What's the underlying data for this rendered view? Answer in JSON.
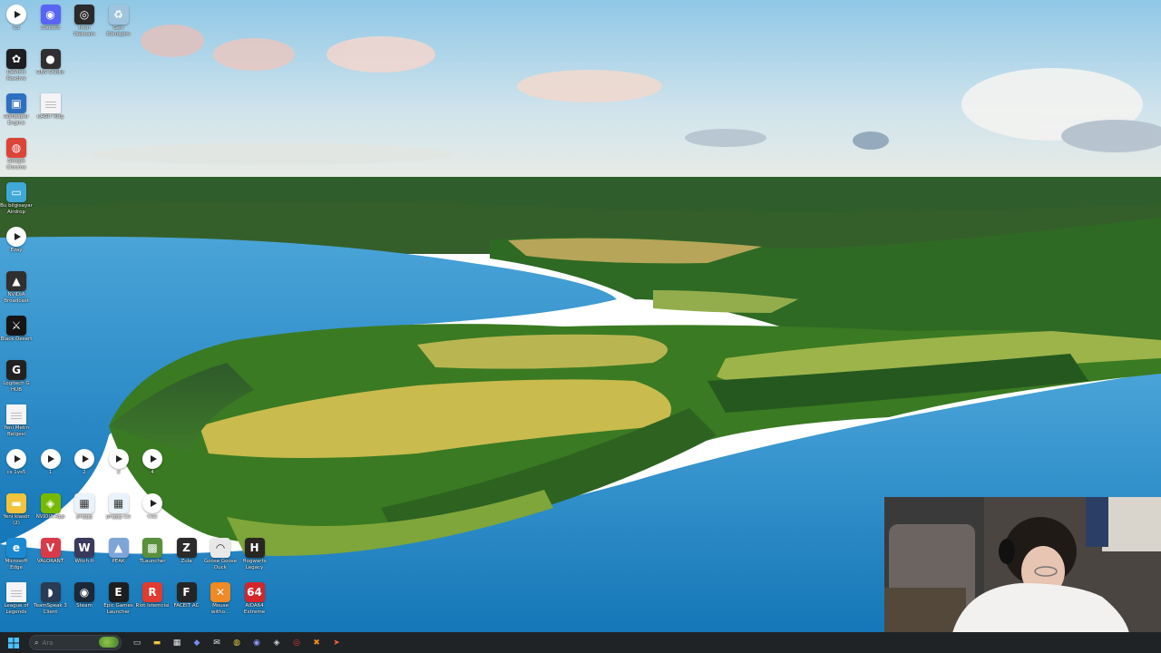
{
  "desktop": {
    "icons": [
      {
        "id": "cs",
        "label": "CS",
        "col": 0,
        "row": 0,
        "glyph": "play",
        "color": "#ffffff",
        "text": ""
      },
      {
        "id": "discord",
        "label": "Discord",
        "col": 1,
        "row": 0,
        "glyph": "char",
        "color": "#5865f2",
        "text": "◉"
      },
      {
        "id": "iriun",
        "label": "Iriun\nWebcam",
        "col": 2,
        "row": 0,
        "glyph": "char",
        "color": "#2a2a2a",
        "text": "◎"
      },
      {
        "id": "recycle",
        "label": "Geri\nDönüşüm",
        "col": 3,
        "row": 0,
        "glyph": "char",
        "color": "#9fc4de",
        "text": "♻"
      },
      {
        "id": "davinci",
        "label": "DaVinci\nResolve",
        "col": 0,
        "row": 1,
        "glyph": "char",
        "color": "#1d1d22",
        "text": "✿"
      },
      {
        "id": "obs",
        "label": "OBS Studio",
        "col": 1,
        "row": 1,
        "glyph": "char",
        "color": "#302e31",
        "text": "●"
      },
      {
        "id": "wallpaper",
        "label": "Wallpaper\nEngine",
        "col": 0,
        "row": 2,
        "glyph": "char",
        "color": "#2f6fbf",
        "text": "▣"
      },
      {
        "id": "kagit",
        "label": "KAĞIT KUŞ",
        "col": 1,
        "row": 2,
        "glyph": "doc",
        "color": "#f4f4f4",
        "text": ""
      },
      {
        "id": "chrome",
        "label": "Google\nChrome",
        "col": 0,
        "row": 3,
        "glyph": "char",
        "color": "#db4437",
        "text": "◍"
      },
      {
        "id": "thispc",
        "label": "Bu bilgisayar\nAirdrop",
        "col": 0,
        "row": 4,
        "glyph": "char",
        "color": "#3fa8d9",
        "text": "▭"
      },
      {
        "id": "ezay",
        "label": "Ezay",
        "col": 0,
        "row": 5,
        "glyph": "play",
        "color": "#ffffff",
        "text": ""
      },
      {
        "id": "nvidia-broadcast",
        "label": "NVIDIA\nBroadcast",
        "col": 0,
        "row": 6,
        "glyph": "char",
        "color": "#2f2f2f",
        "text": "▲"
      },
      {
        "id": "black-desert",
        "label": "Black Desert",
        "col": 0,
        "row": 7,
        "glyph": "char",
        "color": "#151515",
        "text": "⚔"
      },
      {
        "id": "logitech",
        "label": "Logitech G\nHUB",
        "col": 0,
        "row": 8,
        "glyph": "char",
        "color": "#222222",
        "text": "G"
      },
      {
        "id": "yeni-metin",
        "label": "Yeni Metin\nBelgesi",
        "col": 0,
        "row": 9,
        "glyph": "doc",
        "color": "#f4f4f4",
        "text": ""
      },
      {
        "id": "cs-two",
        "label": "cs 1vs5",
        "col": 0,
        "row": 10,
        "glyph": "play",
        "color": "#ffffff",
        "text": ""
      },
      {
        "id": "v1",
        "label": "1",
        "col": 1,
        "row": 10,
        "glyph": "play",
        "color": "#ffffff",
        "text": ""
      },
      {
        "id": "v2",
        "label": "2",
        "col": 2,
        "row": 10,
        "glyph": "play",
        "color": "#ffffff",
        "text": ""
      },
      {
        "id": "v3",
        "label": "3",
        "col": 3,
        "row": 10,
        "glyph": "play",
        "color": "#ffffff",
        "text": ""
      },
      {
        "id": "v4",
        "label": "4",
        "col": 4,
        "row": 10,
        "glyph": "play",
        "color": "#ffffff",
        "text": ""
      },
      {
        "id": "yeni-klasor",
        "label": "Yeni klasör\n(2)",
        "col": 0,
        "row": 11,
        "glyph": "char",
        "color": "#f2c33c",
        "text": "▬"
      },
      {
        "id": "nvidia-app",
        "label": "NVIDIA App",
        "col": 1,
        "row": 11,
        "glyph": "char",
        "color": "#76b900",
        "text": "◈"
      },
      {
        "id": "pnggg",
        "label": "pnggg",
        "col": 2,
        "row": 11,
        "glyph": "char",
        "color": "#eaf3fb",
        "text": "▦"
      },
      {
        "id": "pnggg2",
        "label": "pnggg (2)",
        "col": 3,
        "row": 11,
        "glyph": "char",
        "color": "#eaf3fb",
        "text": "▦"
      },
      {
        "id": "cs2",
        "label": "CS2",
        "col": 4,
        "row": 11,
        "glyph": "play",
        "color": "#ffffff",
        "text": ""
      },
      {
        "id": "edge",
        "label": "Microsoft\nEdge",
        "col": 0,
        "row": 12,
        "glyph": "char",
        "color": "#1b8ad3",
        "text": "e"
      },
      {
        "id": "valorant",
        "label": "VALORANT",
        "col": 1,
        "row": 12,
        "glyph": "char",
        "color": "#d93a48",
        "text": "V"
      },
      {
        "id": "witchit",
        "label": "Witch It",
        "col": 2,
        "row": 12,
        "glyph": "char",
        "color": "#3a3a5c",
        "text": "W"
      },
      {
        "id": "peak",
        "label": "PEAK",
        "col": 3,
        "row": 12,
        "glyph": "char",
        "color": "#7ea5d8",
        "text": "▲"
      },
      {
        "id": "tlauncher",
        "label": "TLauncher",
        "col": 4,
        "row": 12,
        "glyph": "char",
        "color": "#5a8f3c",
        "text": "▩"
      },
      {
        "id": "zula",
        "label": "Zula",
        "col": 5,
        "row": 12,
        "glyph": "char",
        "color": "#2b2b2b",
        "text": "Z"
      },
      {
        "id": "goose",
        "label": "Goose Goose\nDuck",
        "col": 6,
        "row": 12,
        "glyph": "char",
        "color": "#e8e8e8",
        "text": "◠"
      },
      {
        "id": "hogwarts",
        "label": "Hogwarts\nLegacy",
        "col": 7,
        "row": 12,
        "glyph": "char",
        "color": "#2a2622",
        "text": "H"
      },
      {
        "id": "lol",
        "label": "League of\nLegends",
        "col": 0,
        "row": 13,
        "glyph": "doc",
        "color": "#f4f4f4",
        "text": ""
      },
      {
        "id": "teamspeak",
        "label": "TeamSpeak 3\nClient",
        "col": 1,
        "row": 13,
        "glyph": "char",
        "color": "#2a3b55",
        "text": "◗"
      },
      {
        "id": "steam",
        "label": "Steam",
        "col": 2,
        "row": 13,
        "glyph": "char",
        "color": "#1b2838",
        "text": "◉"
      },
      {
        "id": "epic",
        "label": "Epic Games\nLauncher",
        "col": 3,
        "row": 13,
        "glyph": "char",
        "color": "#1e1e1e",
        "text": "E"
      },
      {
        "id": "riot",
        "label": "Riot İstemcisi",
        "col": 4,
        "row": 13,
        "glyph": "char",
        "color": "#e03c31",
        "text": "R"
      },
      {
        "id": "faceit",
        "label": "FACEIT AC",
        "col": 5,
        "row": 13,
        "glyph": "char",
        "color": "#252525",
        "text": "F"
      },
      {
        "id": "mouse",
        "label": "Mouse\nwitho...",
        "col": 6,
        "row": 13,
        "glyph": "char",
        "color": "#f08a24",
        "text": "✕"
      },
      {
        "id": "aida64",
        "label": "AIDA64\nExtreme",
        "col": 7,
        "row": 13,
        "glyph": "char",
        "color": "#d3262b",
        "text": "64"
      }
    ]
  },
  "taskbar": {
    "search_placeholder": "Ara",
    "icons": [
      {
        "name": "task-view-icon",
        "glyph": "▭",
        "color": "#cfd3d6"
      },
      {
        "name": "file-explorer-icon",
        "glyph": "▬",
        "color": "#f2c33c"
      },
      {
        "name": "store-icon",
        "glyph": "▦",
        "color": "#e8e8e8"
      },
      {
        "name": "copilot-icon",
        "glyph": "◆",
        "color": "#7c8cf2"
      },
      {
        "name": "mail-icon",
        "glyph": "✉",
        "color": "#e8e8e8"
      },
      {
        "name": "chrome-icon",
        "glyph": "◍",
        "color": "#e4c441"
      },
      {
        "name": "discord-icon",
        "glyph": "◉",
        "color": "#8a95f5"
      },
      {
        "name": "steam-icon",
        "glyph": "◈",
        "color": "#cfd3d6"
      },
      {
        "name": "riot-icon",
        "glyph": "◎",
        "color": "#e03c31"
      },
      {
        "name": "faceit-icon",
        "glyph": "✖",
        "color": "#f08a24"
      },
      {
        "name": "arrow-icon",
        "glyph": "➤",
        "color": "#f0643a"
      }
    ]
  },
  "colors": {
    "taskbar": "#1f2326",
    "windows_logo": "#4cc2ff"
  }
}
